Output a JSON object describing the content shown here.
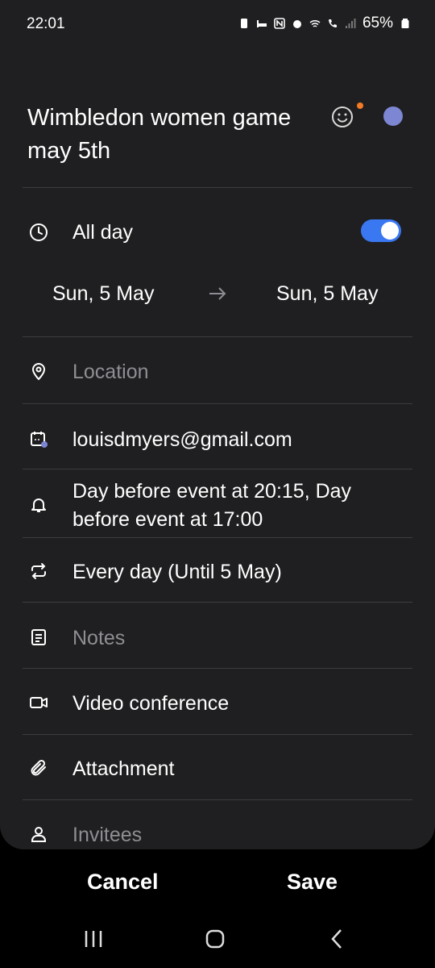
{
  "status_bar": {
    "time": "22:01",
    "battery": "65%"
  },
  "event": {
    "title": "Wimbledon women game may 5th",
    "color": "#7d86d2",
    "all_day_label": "All day",
    "all_day_on": true,
    "start_date": "Sun, 5 May",
    "end_date": "Sun, 5 May"
  },
  "fields": {
    "location_placeholder": "Location",
    "calendar_account": "louisdmyers@gmail.com",
    "reminders": "Day before event at 20:15, Day before event at 17:00",
    "repeat": "Every day (Until 5 May)",
    "notes_placeholder": "Notes",
    "video_conference": "Video conference",
    "attachment": "Attachment",
    "invitees_placeholder": "Invitees"
  },
  "actions": {
    "cancel_label": "Cancel",
    "save_label": "Save"
  },
  "colors": {
    "accent_toggle": "#3a78f2",
    "notification_dot": "#f47a25",
    "background": "#1f1f21"
  },
  "icons": [
    "clock-icon",
    "location-pin-icon",
    "calendar-account-icon",
    "bell-icon",
    "repeat-icon",
    "notes-icon",
    "video-icon",
    "paperclip-icon",
    "person-icon",
    "emoji-icon"
  ]
}
